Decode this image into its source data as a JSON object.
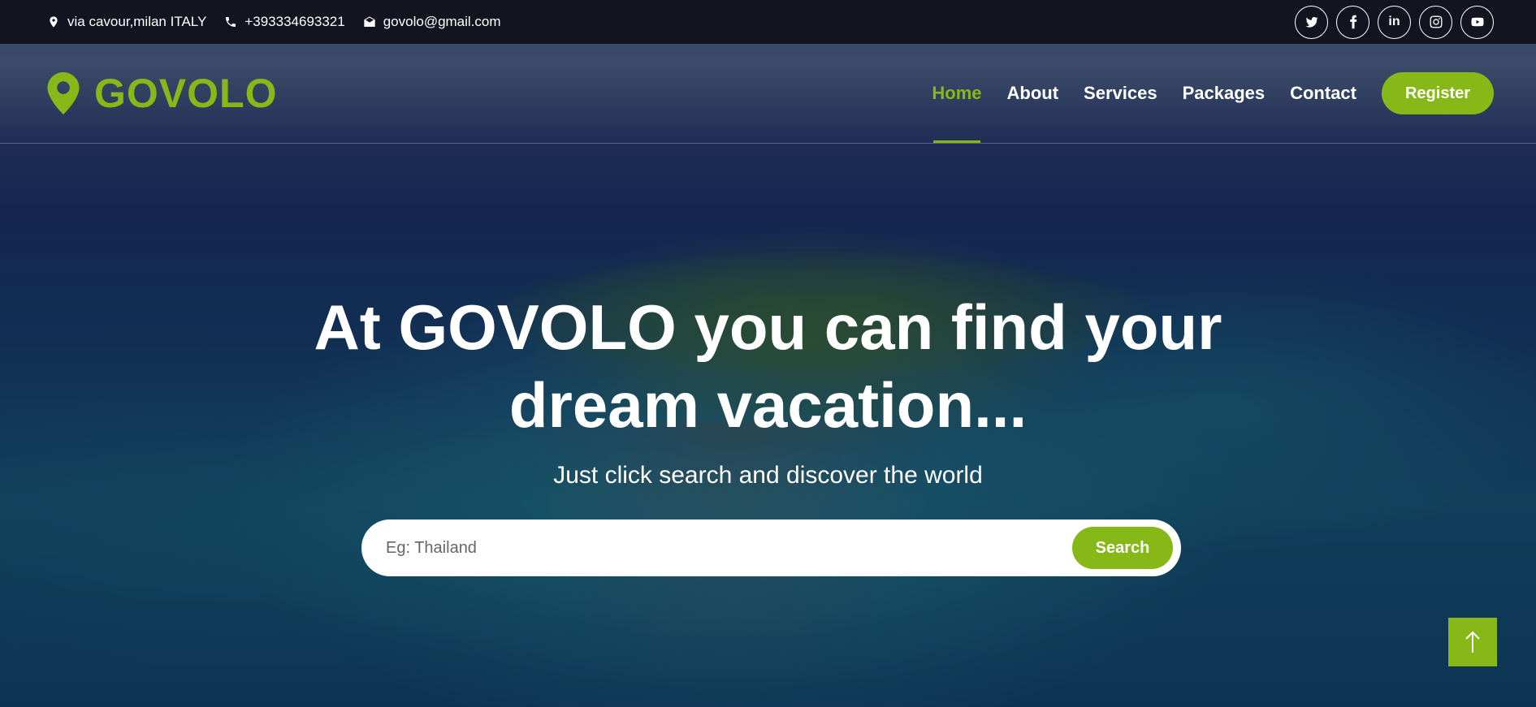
{
  "topbar": {
    "address": "via cavour,milan ITALY",
    "phone": "+393334693321",
    "email": "govolo@gmail.com",
    "socials": [
      "twitter-icon",
      "facebook-icon",
      "linkedin-icon",
      "instagram-icon",
      "youtube-icon"
    ]
  },
  "brand": {
    "name": "GOVOLO",
    "icon": "map-marker-icon",
    "color": "#86b817"
  },
  "nav": {
    "items": [
      {
        "label": "Home",
        "active": true
      },
      {
        "label": "About",
        "active": false
      },
      {
        "label": "Services",
        "active": false
      },
      {
        "label": "Packages",
        "active": false
      },
      {
        "label": "Contact",
        "active": false
      }
    ],
    "register_label": "Register"
  },
  "hero": {
    "title_line1": "At GOVOLO you can find your",
    "title_line2": "dream vacation...",
    "subtitle": "Just click search and discover the world"
  },
  "search": {
    "placeholder": "Eg: Thailand",
    "button_label": "Search"
  },
  "back_to_top": {
    "icon": "arrow-up-icon"
  },
  "colors": {
    "accent": "#86b817",
    "topbar_bg": "#13141f"
  }
}
